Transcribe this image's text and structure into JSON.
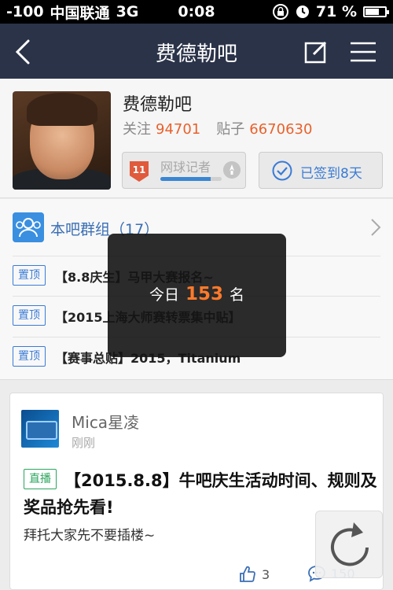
{
  "status_bar": {
    "signal": "-100",
    "carrier": "中国联通",
    "network": "3G",
    "time": "0:08",
    "battery": "71 %",
    "battery_level": 0.71
  },
  "nav": {
    "title": "费德勒吧",
    "icons": [
      "back-icon",
      "edit-icon",
      "menu-icon"
    ]
  },
  "forum": {
    "name": "费德勒吧",
    "follow_label": "关注",
    "follow_count": "94701",
    "posts_label": "贴子",
    "posts_count": "6670630",
    "level_number": "11",
    "level_title": "网球记者",
    "level_progress": 0.82,
    "signed_label": "已签到8天"
  },
  "group": {
    "label": "本吧群组（17）",
    "pinned": [
      {
        "tag": "置顶",
        "text": "【8.8庆生】马甲大赛报名~"
      },
      {
        "tag": "置顶",
        "text": "【2015上海大师赛转票集中贴】"
      },
      {
        "tag": "置顶",
        "text": "【赛事总贴】2015，Titanium"
      }
    ]
  },
  "post": {
    "author": "Mica星凌",
    "time": "刚刚",
    "tag": "直播",
    "title": "【2015.8.8】牛吧庆生活动时间、规则及奖品抢先看!",
    "body": "拜托大家先不要插楼~",
    "likes": "3",
    "comments": "150"
  },
  "toast": {
    "prefix": "今日",
    "count": "153",
    "suffix": "名"
  },
  "colors": {
    "nav_bg": "#2b3349",
    "accent_blue": "#3a7bd5",
    "accent_orange": "#e8612c",
    "live_green": "#2aa55e"
  }
}
